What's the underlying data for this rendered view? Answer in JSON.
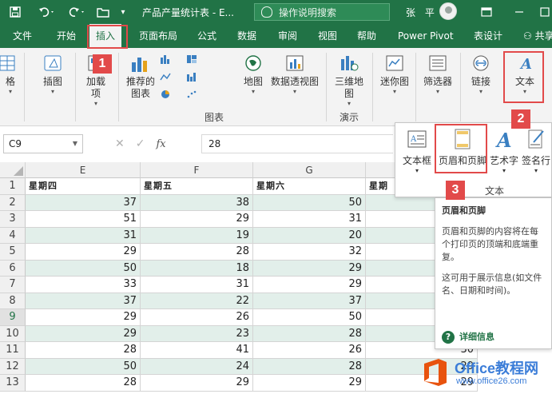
{
  "titlebar": {
    "doc_title": "产品产量统计表 - E...",
    "search_placeholder": "操作说明搜索",
    "user_name": "张 平"
  },
  "tabs": [
    "文件",
    "开始",
    "插入",
    "页面布局",
    "公式",
    "数据",
    "审阅",
    "视图",
    "帮助",
    "Power Pivot",
    "表设计",
    "共享"
  ],
  "active_tab": "插入",
  "ribbon": {
    "table_partial": "格",
    "illustrations": "插图",
    "addins": "加载项",
    "recommended_charts": "推荐的图表",
    "charts_group": "图表",
    "map": "地图",
    "pivot_chart": "数据透视图",
    "map3d": "三维地图",
    "tours_group": "演示",
    "sparklines": "迷你图",
    "slicer": "筛选器",
    "link": "链接",
    "text": "文本"
  },
  "formula_bar": {
    "name_box": "C9",
    "formula": "28",
    "fx": "fx"
  },
  "sheet": {
    "columns": [
      "E",
      "F",
      "G"
    ],
    "header_row": [
      "星期四",
      "星期五",
      "星期六",
      "星期"
    ],
    "row_numbers": [
      "1",
      "2",
      "3",
      "4",
      "5",
      "6",
      "7",
      "8",
      "9",
      "10",
      "11",
      "12",
      "13"
    ],
    "rows": [
      [
        "37",
        "38",
        "50",
        ""
      ],
      [
        "51",
        "29",
        "31",
        ""
      ],
      [
        "31",
        "19",
        "20",
        ""
      ],
      [
        "29",
        "28",
        "32",
        ""
      ],
      [
        "50",
        "18",
        "29",
        ""
      ],
      [
        "33",
        "31",
        "29",
        ""
      ],
      [
        "37",
        "22",
        "37",
        ""
      ],
      [
        "29",
        "26",
        "50",
        ""
      ],
      [
        "29",
        "23",
        "28",
        ""
      ],
      [
        "28",
        "41",
        "26",
        "30"
      ],
      [
        "50",
        "24",
        "28",
        "29"
      ],
      [
        "28",
        "29",
        "29",
        "29"
      ]
    ],
    "selected_row": "9"
  },
  "text_panel": {
    "items": [
      "文本框",
      "页眉和页脚",
      "艺术字",
      "签名行"
    ],
    "group_label": "文本"
  },
  "tooltip": {
    "title": "页眉和页脚",
    "body1": "页眉和页脚的内容将在每个打印页的顶端和底端重复。",
    "body2": "这可用于展示信息(如文件名、日期和时间)。",
    "more": "详细信息"
  },
  "badges": [
    "1",
    "2",
    "3"
  ],
  "watermark": {
    "brand": "Office教程网",
    "url": "www.office26.com"
  },
  "colors": {
    "excel_green": "#217346",
    "band": "#e2efea",
    "highlight_red": "#e24a4a"
  }
}
